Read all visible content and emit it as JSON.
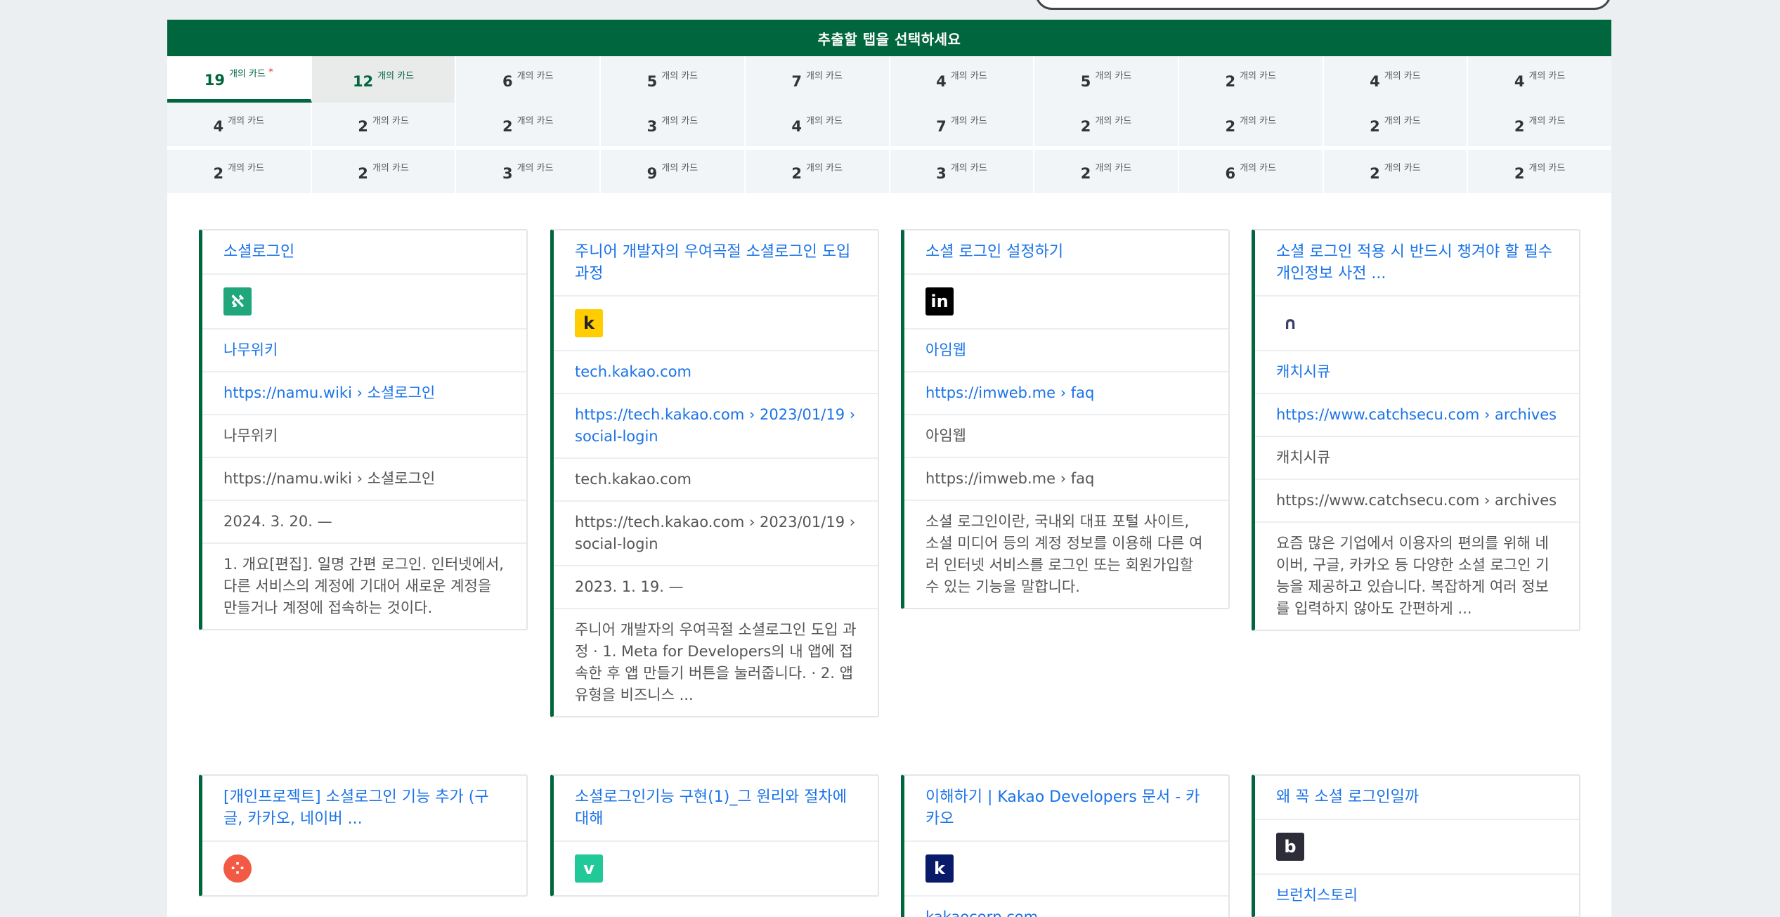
{
  "header": {
    "title": "추출할 탭을 선택하세요"
  },
  "tabs": {
    "unit": "개의 카드",
    "rows": [
      [
        {
          "count": "19",
          "state": "active",
          "star": "*"
        },
        {
          "count": "12",
          "state": "hover"
        },
        {
          "count": "6"
        },
        {
          "count": "5"
        },
        {
          "count": "7"
        },
        {
          "count": "4"
        },
        {
          "count": "5"
        },
        {
          "count": "2"
        },
        {
          "count": "4"
        },
        {
          "count": "4"
        }
      ],
      [
        {
          "count": "4"
        },
        {
          "count": "2"
        },
        {
          "count": "2"
        },
        {
          "count": "3"
        },
        {
          "count": "4"
        },
        {
          "count": "7"
        },
        {
          "count": "2"
        },
        {
          "count": "2"
        },
        {
          "count": "2"
        },
        {
          "count": "2"
        }
      ],
      [
        {
          "count": "2"
        },
        {
          "count": "2"
        },
        {
          "count": "3"
        },
        {
          "count": "9"
        },
        {
          "count": "2"
        },
        {
          "count": "3"
        },
        {
          "count": "2"
        },
        {
          "count": "6"
        },
        {
          "count": "2"
        },
        {
          "count": "2"
        }
      ]
    ]
  },
  "cards": [
    {
      "title": "소셜로그인",
      "favicon": {
        "name": "namuwiki-icon",
        "bg": "#1fa67a",
        "glyph": "ℵ"
      },
      "site": "나무위키",
      "url": "https://namu.wiki › 소셜로그인",
      "site_plain": "나무위키",
      "url_plain": "https://namu.wiki › 소셜로그인",
      "date": "2024. 3. 20. —",
      "desc": "1. 개요[편집]. 일명 간편 로그인. 인터넷에서, 다른 서비스의 계정에 기대어 새로운 계정을 만들거나 계정에 접속하는 것이다."
    },
    {
      "title": "주니어 개발자의 우여곡절 소셜로그인 도입 과정",
      "favicon": {
        "name": "kakao-tech-icon",
        "bg": "#ffcd00",
        "glyph": "k",
        "color": "#222"
      },
      "site": "tech.kakao.com",
      "url": "https://tech.kakao.com › 2023/01/19 › social-login",
      "site_plain": "tech.kakao.com",
      "url_plain": "https://tech.kakao.com › 2023/01/19 › social-login",
      "date": "2023. 1. 19. —",
      "desc": "주니어 개발자의 우여곡절 소셜로그인 도입 과정 · 1. Meta for Developers의 내 앱에 접속한 후 앱 만들기 버튼을 눌러줍니다. · 2. 앱 유형을 비즈니스 ..."
    },
    {
      "title": "소셜 로그인 설정하기",
      "favicon": {
        "name": "imweb-icon",
        "bg": "#000000",
        "glyph": "in"
      },
      "site": "아임웹",
      "url": "https://imweb.me › faq",
      "site_plain": "아임웹",
      "url_plain": "https://imweb.me › faq",
      "date": "",
      "desc": "소셜 로그인이란, 국내외 대표 포털 사이트, 소셜 미디어 등의 계정 정보를 이용해 다른 여러 인터넷 서비스를 로그인 또는 회원가입할 수 있는 기능을 말합니다."
    },
    {
      "title": "소셜 로그인 적용 시 반드시 챙겨야 할 필수 개인정보 사전 ...",
      "favicon": {
        "name": "catchsecu-icon",
        "bg": "#ffffff",
        "glyph": "∩",
        "color": "#3a3f6b"
      },
      "site": "캐치시큐",
      "url": "https://www.catchsecu.com › archives",
      "site_plain": "캐치시큐",
      "url_plain": "https://www.catchsecu.com › archives",
      "date": "",
      "desc": "요즘 많은 기업에서 이용자의 편의를 위해 네이버, 구글, 카카오 등 다양한 소셜 로그인 기능을 제공하고 있습니다. 복잡하게 여러 정보를 입력하지 않아도 간편하게 ..."
    },
    {
      "title": "[개인프로젝트] 소셜로그인 기능 추가 (구글, 카카오, 네이버 ...",
      "favicon": {
        "name": "tistory-icon",
        "bg": "#f25a44",
        "glyph": "⁘",
        "round": true
      }
    },
    {
      "title": "소셜로그인기능 구현(1)_그 원리와 절차에 대해",
      "favicon": {
        "name": "velog-icon",
        "bg": "#20c997",
        "glyph": "v"
      }
    },
    {
      "title": "이해하기 | Kakao Developers 문서 - 카카오",
      "favicon": {
        "name": "kakaocorp-icon",
        "bg": "#0a1a6b",
        "glyph": "k"
      },
      "site": "kakaocorp.com"
    },
    {
      "title": "왜 꼭 소셜 로그인일까",
      "favicon": {
        "name": "brunch-icon",
        "bg": "#2d2d3a",
        "glyph": "b"
      },
      "site": "브런치스토리"
    }
  ]
}
